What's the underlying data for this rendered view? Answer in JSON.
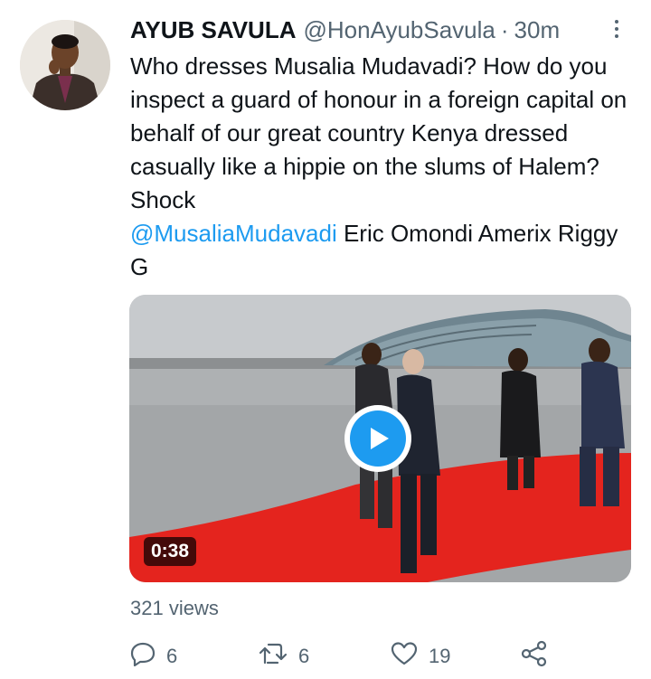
{
  "tweet": {
    "author_name": "AYUB SAVULA",
    "handle": "@HonAyubSavula",
    "separator": "·",
    "time": "30m",
    "text": "Who dresses Musalia Mudavadi? How do you inspect a guard of honour in a foreign capital on behalf of our great country Kenya dressed casually like a hippie on the slums of Halem? Shock",
    "mention": "@MusaliaMudavadi",
    "mention_trailing": " Eric Omondi Amerix Riggy G",
    "video_duration": "0:38",
    "views": "321 views"
  },
  "actions": {
    "reply_count": "6",
    "retweet_count": "6",
    "like_count": "19"
  },
  "icons": {
    "avatar": "profile-photo",
    "more": "more-vertical-icon",
    "play": "play-icon",
    "reply": "reply-icon",
    "retweet": "retweet-icon",
    "like": "heart-icon",
    "share": "share-icon"
  },
  "colors": {
    "link": "#1d9bf0",
    "secondary_text": "#536471",
    "primary_text": "#0f1419",
    "red_carpet": "#e4241e"
  }
}
